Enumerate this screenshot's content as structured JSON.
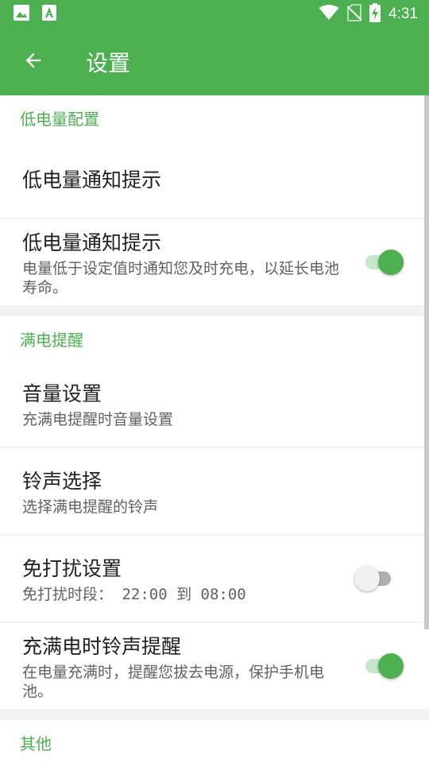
{
  "status_bar": {
    "time": "4:31",
    "icons": [
      "image-icon",
      "font-app-icon",
      "wifi-icon",
      "no-sim-icon",
      "battery-charging-icon"
    ]
  },
  "toolbar": {
    "title": "设置",
    "back_icon": "arrow-left-icon"
  },
  "sections": {
    "low_battery": {
      "header": "低电量配置",
      "items": [
        {
          "title": "低电量通知提示"
        },
        {
          "title": "低电量通知提示",
          "summary": "电量低于设定值时通知您及时充电，以延长电池寿命。",
          "switch_on": true
        }
      ]
    },
    "full_charge": {
      "header": "满电提醒",
      "items": [
        {
          "title": "音量设置",
          "summary": "充满电提醒时音量设置"
        },
        {
          "title": "铃声选择",
          "summary": "选择满电提醒的铃声"
        },
        {
          "title": "免打扰设置",
          "summary": "免打扰时段： 22:00 到 08:00",
          "switch_on": false
        },
        {
          "title": "充满电时铃声提醒",
          "summary": "在电量充满时，提醒您拔去电源，保护手机电池。",
          "switch_on": true
        }
      ]
    },
    "other": {
      "header": "其他"
    }
  },
  "colors": {
    "accent": "#4caf50",
    "accent_light": "#c8e6c9",
    "divider": "#f2f2f2",
    "text_primary": "#212121",
    "text_secondary": "#616161"
  }
}
